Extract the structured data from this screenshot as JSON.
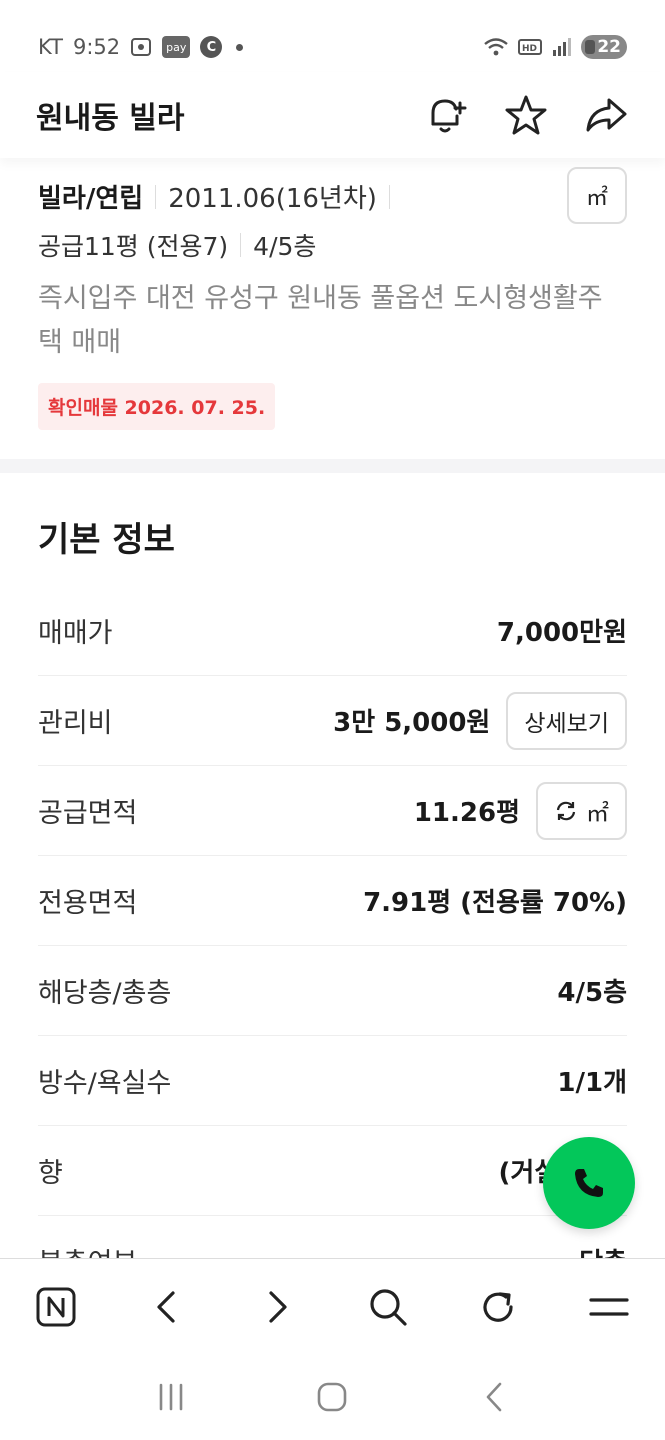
{
  "status_bar": {
    "carrier": "KT",
    "time": "9:52",
    "pay_chip": "pay",
    "c_chip": "C",
    "battery": "22"
  },
  "header": {
    "title": "원내동 빌라"
  },
  "summary": {
    "type": "빌라/연립",
    "built": "2011.06(16년차)",
    "area": "공급11평 (전용7)",
    "floor": "4/5층",
    "description": "즉시입주 대전 유성구 원내동 풀옵션 도시형생활주택 매매",
    "badge": "확인매물 2026. 07. 25.",
    "unit_toggle": "㎡"
  },
  "basic_info": {
    "title": "기본 정보",
    "rows": [
      {
        "label": "매매가",
        "value": "7,000만원"
      },
      {
        "label": "관리비",
        "value": "3만 5,000원",
        "button": "상세보기"
      },
      {
        "label": "공급면적",
        "value": "11.26평",
        "button": "㎡"
      },
      {
        "label": "전용면적",
        "value": "7.91평 (전용률 70%)"
      },
      {
        "label": "해당층/총층",
        "value": "4/5층"
      },
      {
        "label": "방수/욕실수",
        "value": "1/1개"
      },
      {
        "label": "향",
        "value": "(거실 기준)"
      },
      {
        "label": "복층여부",
        "value": "단층"
      }
    ]
  },
  "colors": {
    "accent_green": "#03c75a",
    "badge_red": "#e5383b"
  }
}
